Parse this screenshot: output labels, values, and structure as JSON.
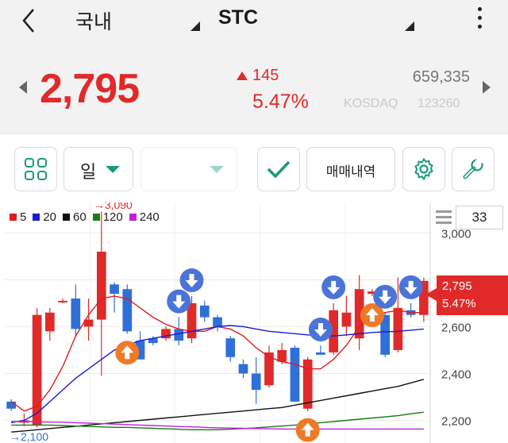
{
  "header": {
    "market_label": "국내",
    "stock_name": "STC",
    "back_icon": "chevron-left-icon",
    "more_icon": "more-vertical-icon"
  },
  "quote": {
    "price": "2,795",
    "change": "145",
    "change_pct": "5.47%",
    "volume": "659,335",
    "exchange": "KOSDAQ",
    "code": "123260",
    "up_color": "#e02a2a",
    "down_color": "#2f6fd8"
  },
  "toolbar": {
    "period_label": "일",
    "trade_history_label": "매매내역",
    "accent": "#1a9a7a"
  },
  "chart": {
    "count_label": "33",
    "current_price_label": "2,795",
    "current_pct_label": "5.47%",
    "ma_legend": [
      {
        "label": "5",
        "color": "#e31b1b"
      },
      {
        "label": "20",
        "color": "#1a1ad0"
      },
      {
        "label": "60",
        "color": "#111111"
      },
      {
        "label": "120",
        "color": "#1a7a1a"
      },
      {
        "label": "240",
        "color": "#c020e0"
      }
    ],
    "high_annot": "→3,090",
    "low_annot": "→2,100"
  },
  "chart_data": {
    "type": "candlestick",
    "y_ticks": [
      "3,000",
      "2,800",
      "2,600",
      "2,400",
      "2,200"
    ],
    "y_tick_values": [
      3000,
      2800,
      2600,
      2400,
      2200
    ],
    "ylim": [
      2100,
      3130
    ],
    "high_label": "3,090",
    "low_label": "2,100",
    "candles": [
      {
        "o": 2280,
        "h": 2290,
        "l": 2240,
        "c": 2250
      },
      {
        "o": 2190,
        "h": 2230,
        "l": 2175,
        "c": 2200
      },
      {
        "o": 2180,
        "h": 2680,
        "l": 2170,
        "c": 2650
      },
      {
        "o": 2580,
        "h": 2680,
        "l": 2540,
        "c": 2660
      },
      {
        "o": 2710,
        "h": 2720,
        "l": 2700,
        "c": 2710
      },
      {
        "o": 2720,
        "h": 2780,
        "l": 2560,
        "c": 2590
      },
      {
        "o": 2600,
        "h": 2720,
        "l": 2540,
        "c": 2630
      },
      {
        "o": 2630,
        "h": 3090,
        "l": 2390,
        "c": 2920
      },
      {
        "o": 2780,
        "h": 2790,
        "l": 2660,
        "c": 2740
      },
      {
        "o": 2760,
        "h": 2780,
        "l": 2570,
        "c": 2580
      },
      {
        "o": 2540,
        "h": 2580,
        "l": 2470,
        "c": 2460
      },
      {
        "o": 2550,
        "h": 2560,
        "l": 2520,
        "c": 2530
      },
      {
        "o": 2550,
        "h": 2600,
        "l": 2540,
        "c": 2590
      },
      {
        "o": 2590,
        "h": 2640,
        "l": 2520,
        "c": 2540
      },
      {
        "o": 2550,
        "h": 2730,
        "l": 2530,
        "c": 2700
      },
      {
        "o": 2690,
        "h": 2710,
        "l": 2620,
        "c": 2640
      },
      {
        "o": 2640,
        "h": 2650,
        "l": 2580,
        "c": 2600
      },
      {
        "o": 2550,
        "h": 2560,
        "l": 2450,
        "c": 2470
      },
      {
        "o": 2440,
        "h": 2460,
        "l": 2380,
        "c": 2400
      },
      {
        "o": 2400,
        "h": 2470,
        "l": 2270,
        "c": 2330
      },
      {
        "o": 2350,
        "h": 2520,
        "l": 2340,
        "c": 2490
      },
      {
        "o": 2450,
        "h": 2530,
        "l": 2440,
        "c": 2500
      },
      {
        "o": 2510,
        "h": 2520,
        "l": 2380,
        "c": 2280
      },
      {
        "o": 2250,
        "h": 2470,
        "l": 2240,
        "c": 2460
      },
      {
        "o": 2490,
        "h": 2520,
        "l": 2480,
        "c": 2480
      },
      {
        "o": 2490,
        "h": 2700,
        "l": 2480,
        "c": 2670
      },
      {
        "o": 2600,
        "h": 2730,
        "l": 2560,
        "c": 2660
      },
      {
        "o": 2550,
        "h": 2820,
        "l": 2500,
        "c": 2760
      },
      {
        "o": 2740,
        "h": 2760,
        "l": 2730,
        "c": 2750
      },
      {
        "o": 2650,
        "h": 2660,
        "l": 2470,
        "c": 2480
      },
      {
        "o": 2500,
        "h": 2810,
        "l": 2490,
        "c": 2680
      },
      {
        "o": 2670,
        "h": 2700,
        "l": 2640,
        "c": 2650
      },
      {
        "o": 2650,
        "h": 2810,
        "l": 2620,
        "c": 2795
      }
    ],
    "ma_lines": [
      {
        "name": "5",
        "values": [
          2280,
          2240,
          2260,
          2330,
          2430,
          2560,
          2650,
          2720,
          2730,
          2720,
          2680,
          2640,
          2610,
          2590,
          2580,
          2580,
          2600,
          2590,
          2560,
          2510,
          2470,
          2450,
          2440,
          2420,
          2420,
          2460,
          2520,
          2600,
          2640,
          2660,
          2670,
          2660,
          2660
        ]
      },
      {
        "name": "20",
        "values": [
          2190,
          2200,
          2230,
          2280,
          2330,
          2380,
          2420,
          2460,
          2500,
          2520,
          2540,
          2550,
          2560,
          2570,
          2580,
          2590,
          2600,
          2605,
          2600,
          2590,
          2580,
          2575,
          2570,
          2565,
          2560,
          2560,
          2565,
          2570,
          2575,
          2578,
          2580,
          2585,
          2590
        ]
      },
      {
        "name": "60",
        "values": [
          2150,
          2155,
          2160,
          2165,
          2170,
          2175,
          2180,
          2185,
          2190,
          2195,
          2200,
          2205,
          2210,
          2215,
          2220,
          2225,
          2230,
          2235,
          2240,
          2245,
          2250,
          2255,
          2265,
          2275,
          2285,
          2295,
          2305,
          2315,
          2325,
          2335,
          2345,
          2360,
          2375
        ]
      },
      {
        "name": "120",
        "values": [
          2180,
          2180,
          2180,
          2180,
          2178,
          2176,
          2174,
          2172,
          2170,
          2170,
          2168,
          2166,
          2164,
          2162,
          2160,
          2160,
          2160,
          2162,
          2165,
          2168,
          2172,
          2176,
          2180,
          2185,
          2190,
          2195,
          2200,
          2205,
          2210,
          2215,
          2220,
          2228,
          2235
        ]
      },
      {
        "name": "240",
        "values": [
          2195,
          2195,
          2194,
          2193,
          2192,
          2190,
          2188,
          2186,
          2184,
          2182,
          2180,
          2178,
          2176,
          2174,
          2172,
          2170,
          2168,
          2167,
          2166,
          2165,
          2164,
          2163,
          2163,
          2163,
          2163,
          2163,
          2163,
          2163,
          2163,
          2163,
          2163,
          2163,
          2163
        ]
      }
    ],
    "signals": [
      {
        "type": "buy",
        "index": 9
      },
      {
        "type": "sell",
        "index": 13
      },
      {
        "type": "sell",
        "index": 14
      },
      {
        "type": "buy",
        "index": 23
      },
      {
        "type": "sell",
        "index": 24
      },
      {
        "type": "sell",
        "index": 25
      },
      {
        "type": "buy",
        "index": 28
      },
      {
        "type": "sell",
        "index": 29
      },
      {
        "type": "sell",
        "index": 31
      }
    ],
    "grid": true
  }
}
